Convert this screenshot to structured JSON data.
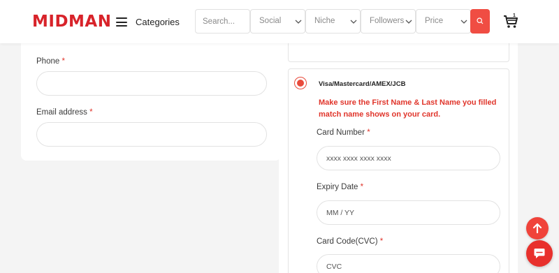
{
  "header": {
    "logo_text": "MIDMAN",
    "categories_label": "Categories",
    "search_placeholder": "Search...",
    "filters": [
      {
        "label": "Social"
      },
      {
        "label": "Niche"
      },
      {
        "label": "Followers"
      },
      {
        "label": "Price"
      }
    ],
    "cart_badge": "1",
    "accent_color": "#f04d43"
  },
  "contact_form": {
    "phone_label": "Phone",
    "email_label": "Email address",
    "required_mark": "*"
  },
  "payment": {
    "method_label": "Visa/Mastercard/AMEX/JCB",
    "warning": "Make sure the First Name & Last Name you filled match name shows on your card.",
    "card_number_label": "Card Number",
    "card_number_placeholder": "xxxx xxxx xxxx xxxx",
    "expiry_label": "Expiry Date",
    "expiry_placeholder": "MM / YY",
    "cvc_label": "Card Code(CVC)",
    "cvc_placeholder": "CVC"
  },
  "icons": {
    "menu": "hamburger-icon",
    "search": "search-icon",
    "cart": "cart-icon",
    "chevron": "chevron-down-icon",
    "scroll_top": "arrow-up-icon",
    "chat": "chat-icon"
  }
}
